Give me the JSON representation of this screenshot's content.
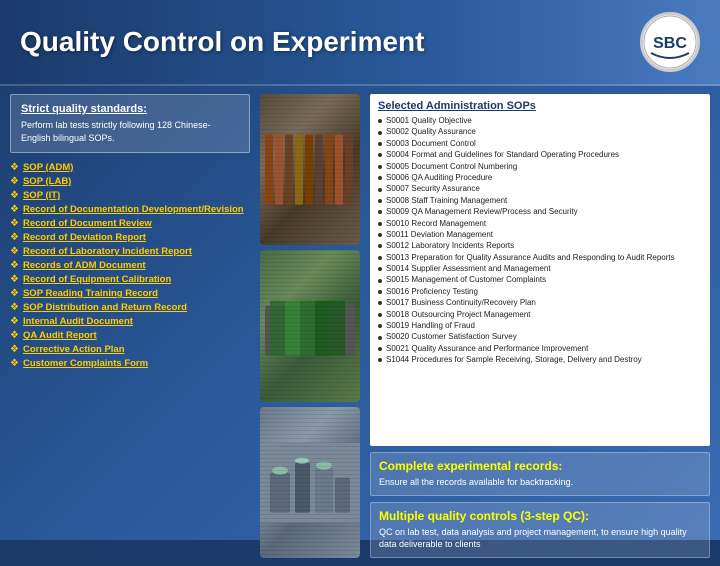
{
  "header": {
    "title": "Quality Control on Experiment",
    "logo_text": "SBC"
  },
  "left_panel": {
    "strict_quality": {
      "title": "Strict quality standards:",
      "description": "Perform  lab tests strictly following 128 Chinese-English bilingual SOPs."
    },
    "list_items": [
      {
        "text": "SOP (ADM)",
        "bullet": "❖"
      },
      {
        "text": "SOP (LAB)",
        "bullet": "❖"
      },
      {
        "text": "SOP (IT)",
        "bullet": "❖"
      },
      {
        "text": "Record of Documentation Development/Revision",
        "bullet": "❖"
      },
      {
        "text": "Record of Document Review",
        "bullet": "❖"
      },
      {
        "text": "Record of Deviation Report",
        "bullet": "❖"
      },
      {
        "text": "Record of Laboratory Incident Report",
        "bullet": "❖"
      },
      {
        "text": "Records of ADM Document",
        "bullet": "❖"
      },
      {
        "text": "Record of Equipment Calibration",
        "bullet": "❖"
      },
      {
        "text": "SOP Reading Training Record",
        "bullet": "❖"
      },
      {
        "text": "SOP Distribution and Return Record",
        "bullet": "❖"
      },
      {
        "text": "Internal Audit Document",
        "bullet": "❖"
      },
      {
        "text": "QA Audit Report",
        "bullet": "❖"
      },
      {
        "text": "Corrective Action Plan",
        "bullet": "❖"
      },
      {
        "text": "Customer Complaints Form",
        "bullet": "❖"
      }
    ]
  },
  "right_panel": {
    "admin_sops": {
      "title": "Selected Administration SOPs",
      "items": [
        "S0001 Quality Objective",
        "S0002 Quality Assurance",
        "S0003 Document Control",
        "S0004 Format and Guidelines for Standard Operating Procedures",
        "S0005 Document Control Numbering",
        "S0006 QA Auditing Procedure",
        "S0007 Security Assurance",
        "S0008 Staff Training Management",
        "S0009 QA Management Review/Process and Security",
        "S0010 Record Management",
        "S0011 Deviation Management",
        "S0012 Laboratory Incidents Reports",
        "S0013 Preparation for Quality Assurance Audits and Responding to Audit Reports",
        "S0014 Supplier Assessment and Management",
        "S0015 Management of Customer Complaints",
        "S0016 Proficiency Testing",
        "S0017 Business Continuity/Recovery Plan",
        "S0018 Outsourcing Project Management",
        "S0019 Handling of Fraud",
        "S0020 Customer Satisfaction Survey",
        "S0021 Quality Assurance and Performance Improvement",
        "S1044 Procedures for Sample Receiving, Storage, Delivery and Destroy"
      ]
    },
    "complete_records": {
      "title": "Complete experimental records:",
      "text": "Ensure all the records available for backtracking."
    },
    "multiple_qc": {
      "title": "Multiple quality controls (3-step QC):",
      "text": "QC on lab test, data analysis and project management, to ensure high quality data deliverable to clients"
    }
  }
}
